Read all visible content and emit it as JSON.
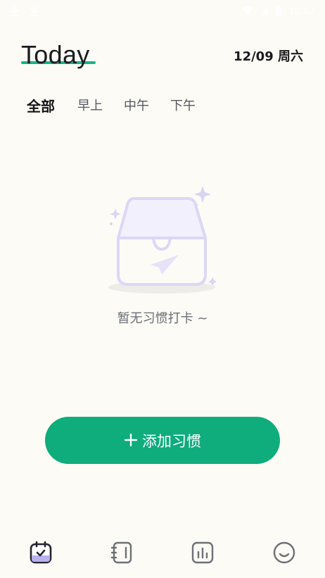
{
  "status_bar": {
    "time": "10:57",
    "icons": [
      "download-icon",
      "download-icon",
      "wifi-icon",
      "signal-icon",
      "battery-icon"
    ]
  },
  "header": {
    "title": "Today",
    "date": "12/09 周六",
    "accent_color": "#17b588"
  },
  "tabs": [
    {
      "label": "全部",
      "active": true
    },
    {
      "label": "早上",
      "active": false
    },
    {
      "label": "中午",
      "active": false
    },
    {
      "label": "下午",
      "active": false
    }
  ],
  "empty_state": {
    "icon": "empty-inbox-icon",
    "message": "暂无习惯打卡 ~"
  },
  "add_button": {
    "icon": "plus-icon",
    "label": "添加习惯",
    "color": "#0fac7c"
  },
  "bottom_nav": {
    "items": [
      {
        "icon": "calendar-check-icon",
        "active": true
      },
      {
        "icon": "notebook-icon",
        "active": false
      },
      {
        "icon": "stats-icon",
        "active": false
      },
      {
        "icon": "smiley-icon",
        "active": false
      }
    ]
  }
}
